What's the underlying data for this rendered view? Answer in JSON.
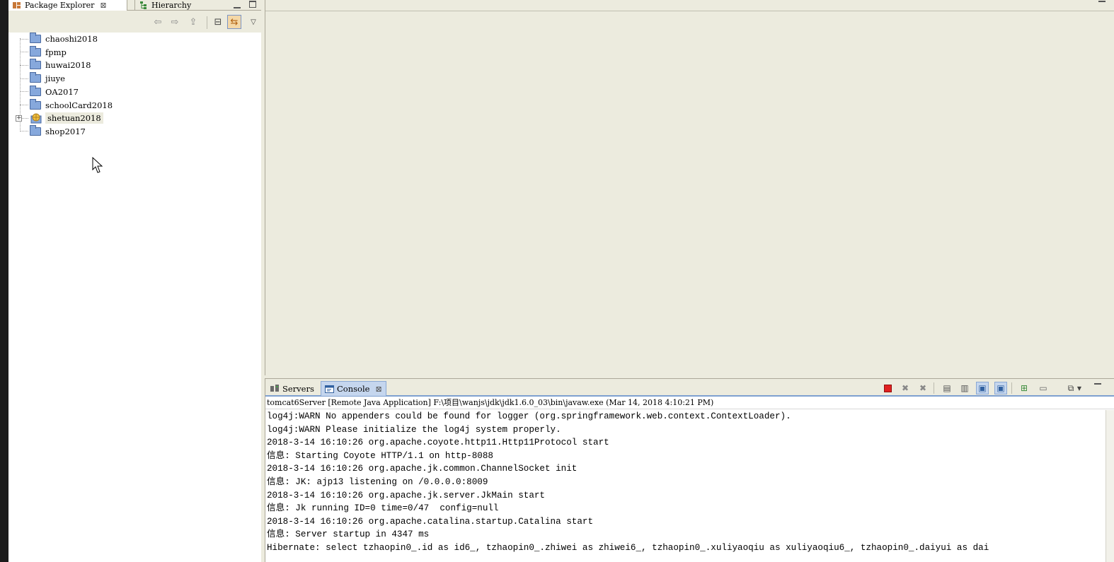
{
  "package_explorer": {
    "tabs": [
      {
        "label": "Package Explorer",
        "active": true
      },
      {
        "label": "Hierarchy",
        "active": false
      }
    ],
    "projects": [
      {
        "name": "chaoshi2018",
        "icon": "folder-icon"
      },
      {
        "name": "fpmp",
        "icon": "folder-icon"
      },
      {
        "name": "huwai2018",
        "icon": "folder-icon"
      },
      {
        "name": "jiuye",
        "icon": "folder-icon"
      },
      {
        "name": "OA2017",
        "icon": "folder-icon"
      },
      {
        "name": "schoolCard2018",
        "icon": "folder-icon"
      },
      {
        "name": "shetuan2018",
        "icon": "web-project-icon",
        "expandable": true,
        "selected": true
      },
      {
        "name": "shop2017",
        "icon": "folder-icon"
      }
    ]
  },
  "console_view": {
    "tabs": [
      {
        "label": "Servers",
        "active": false
      },
      {
        "label": "Console",
        "active": true
      }
    ],
    "process_label": "tomcat6Server [Remote Java Application] F:\\项目\\wanjs\\jdk\\jdk1.6.0_03\\bin\\javaw.exe (Mar 14, 2018 4:10:21 PM)",
    "log_lines": [
      "log4j:WARN No appenders could be found for logger (org.springframework.web.context.ContextLoader).",
      "log4j:WARN Please initialize the log4j system properly.",
      "2018-3-14 16:10:26 org.apache.coyote.http11.Http11Protocol start",
      "信息: Starting Coyote HTTP/1.1 on http-8088",
      "2018-3-14 16:10:26 org.apache.jk.common.ChannelSocket init",
      "信息: JK: ajp13 listening on /0.0.0.0:8009",
      "2018-3-14 16:10:26 org.apache.jk.server.JkMain start",
      "信息: Jk running ID=0 time=0/47  config=null",
      "2018-3-14 16:10:26 org.apache.catalina.startup.Catalina start",
      "信息: Server startup in 4347 ms",
      "Hibernate: select tzhaopin0_.id as id6_, tzhaopin0_.zhiwei as zhiwei6_, tzhaopin0_.xuliyaoqiu as xuliyaoqiu6_, tzhaopin0_.daiyui as dai"
    ]
  },
  "colors": {
    "chrome": "#ecebde",
    "active_tab": "#c5d6ee",
    "terminate_red": "#e02020"
  }
}
